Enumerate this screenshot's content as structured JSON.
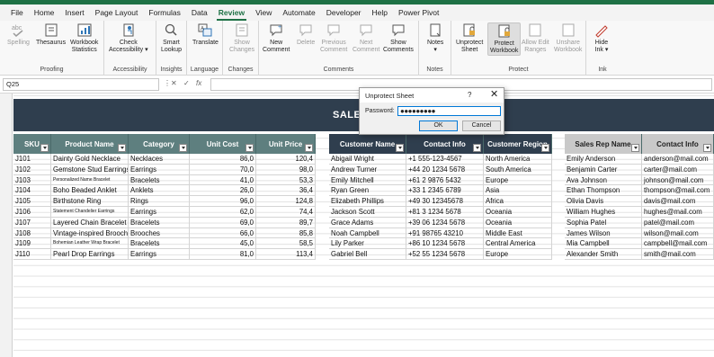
{
  "menu": [
    "File",
    "Home",
    "Insert",
    "Page Layout",
    "Formulas",
    "Data",
    "Review",
    "View",
    "Automate",
    "Developer",
    "Help",
    "Power Pivot"
  ],
  "ribbon": {
    "spelling": "Spelling",
    "thesaurus": "Thesaurus",
    "workbook_stats1": "Workbook",
    "workbook_stats2": "Statistics",
    "proofing": "Proofing",
    "check_acc1": "Check",
    "check_acc2": "Accessibility ▾",
    "accessibility": "Accessibility",
    "smart1": "Smart",
    "smart2": "Lookup",
    "insights": "Insights",
    "translate": "Translate",
    "language": "Language",
    "show_changes1": "Show",
    "show_changes2": "Changes",
    "changes": "Changes",
    "new_comment1": "New",
    "new_comment2": "Comment",
    "delete": "Delete",
    "prev1": "Previous",
    "prev2": "Comment",
    "next1": "Next",
    "next2": "Comment",
    "showc1": "Show",
    "showc2": "Comments",
    "comments": "Comments",
    "notes1": "Notes",
    "notes2": "▾",
    "notes": "Notes",
    "unprotect1": "Unprotect",
    "unprotect2": "Sheet",
    "protect1": "Protect",
    "protect2": "Workbook",
    "allow1": "Allow Edit",
    "allow2": "Ranges",
    "unshare1": "Unshare",
    "unshare2": "Workbook",
    "protect": "Protect",
    "hide1": "Hide",
    "hide2": "Ink ▾",
    "ink": "Ink"
  },
  "namebox": "Q25",
  "fx": "fx",
  "banner_title": "SALES",
  "table1": {
    "headers": [
      "SKU",
      "Product Name",
      "Category",
      "Unit Cost",
      "Unit Price"
    ],
    "color": "#5e7f7f",
    "rows": [
      [
        "J101",
        "Dainty Gold Necklace",
        "Necklaces",
        "86,0",
        "120,4"
      ],
      [
        "J102",
        "Gemstone Stud Earrings",
        "Earrings",
        "70,0",
        "98,0"
      ],
      [
        "J103",
        "Personalized Name Bracelet",
        "Bracelets",
        "41,0",
        "53,3"
      ],
      [
        "J104",
        "Boho Beaded Anklet",
        "Anklets",
        "26,0",
        "36,4"
      ],
      [
        "J105",
        "Birthstone Ring",
        "Rings",
        "96,0",
        "124,8"
      ],
      [
        "J106",
        "Statement Chandelier Earrings",
        "Earrings",
        "62,0",
        "74,4"
      ],
      [
        "J107",
        "Layered Chain Bracelet",
        "Bracelets",
        "69,0",
        "89,7"
      ],
      [
        "J108",
        "Vintage-inspired Brooch",
        "Brooches",
        "66,0",
        "85,8"
      ],
      [
        "J109",
        "Bohemian Leather Wrap Bracelet",
        "Bracelets",
        "45,0",
        "58,5"
      ],
      [
        "J110",
        "Pearl Drop Earrings",
        "Earrings",
        "81,0",
        "113,4"
      ]
    ]
  },
  "table2": {
    "headers": [
      "Customer Name",
      "Contact Info",
      "Customer Region"
    ],
    "color": "#2f3e4e",
    "rows": [
      [
        "Abigail Wright",
        "+1 555-123-4567",
        "North America"
      ],
      [
        "Andrew Turner",
        "+44 20 1234 5678",
        "South America"
      ],
      [
        "Emily Mitchell",
        "+61 2 9876 5432",
        "Europe"
      ],
      [
        "Ryan Green",
        "+33 1 2345 6789",
        "Asia"
      ],
      [
        "Elizabeth Phillips",
        "+49 30 12345678",
        "Africa"
      ],
      [
        "Jackson Scott",
        "+81 3 1234 5678",
        "Oceania"
      ],
      [
        "Grace Adams",
        "+39 06 1234 5678",
        "Oceania"
      ],
      [
        "Noah Campbell",
        "+91 98765 43210",
        "Middle East"
      ],
      [
        "Lily Parker",
        "+86 10 1234 5678",
        "Central America"
      ],
      [
        "Gabriel Bell",
        "+52 55 1234 5678",
        "Europe"
      ]
    ]
  },
  "table3": {
    "headers": [
      "Sales Rep Name",
      "Contact Info"
    ],
    "color": "#c9c9c9",
    "rows": [
      [
        "Emily Anderson",
        "anderson@mail.com"
      ],
      [
        "Benjamin Carter",
        "carter@mail.com"
      ],
      [
        "Ava Johnson",
        "johnson@mail.com"
      ],
      [
        "Ethan Thompson",
        "thompson@mail.com"
      ],
      [
        "Olivia Davis",
        "davis@mail.com"
      ],
      [
        "William Hughes",
        "hughes@mail.com"
      ],
      [
        "Sophia Patel",
        "patel@mail.com"
      ],
      [
        "James Wilson",
        "wilson@mail.com"
      ],
      [
        "Mia Campbell",
        "campbell@mail.com"
      ],
      [
        "Alexander Smith",
        "smith@mail.com"
      ]
    ]
  },
  "dialog": {
    "title": "Unprotect Sheet",
    "help": "?",
    "close": "✕",
    "label": "Password:",
    "value": "●●●●●●●●●",
    "ok": "OK",
    "cancel": "Cancel"
  }
}
